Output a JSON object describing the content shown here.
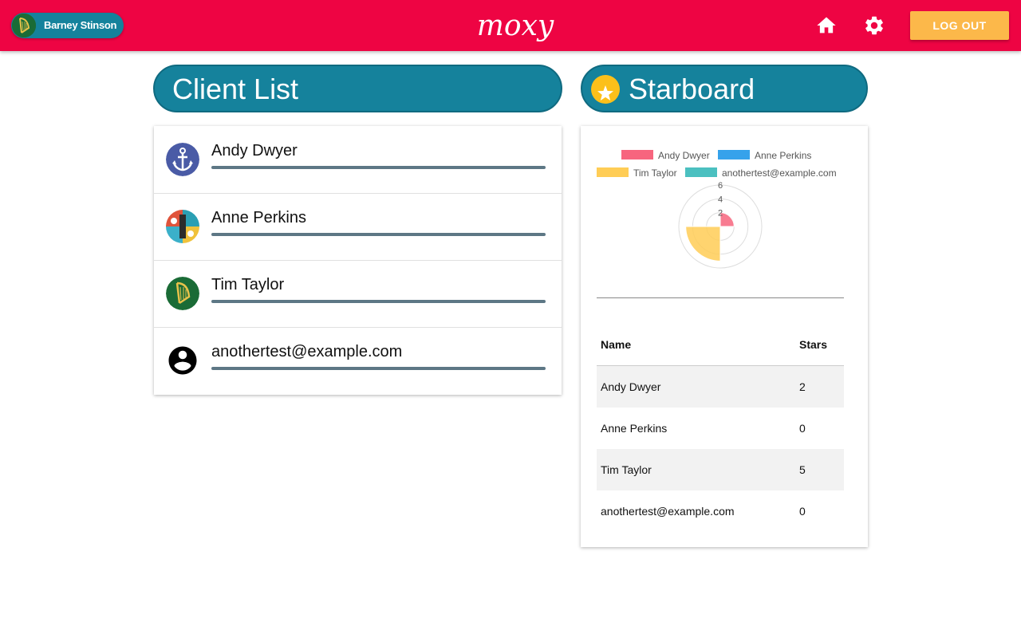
{
  "header": {
    "user_name": "Barney Stinson",
    "logo_text": "moxy",
    "logout_label": "LOG OUT",
    "icons": [
      "harp-icon",
      "home-icon",
      "gear-icon"
    ],
    "colors": {
      "bar": "#ee0443",
      "accent": "#15829c",
      "logout": "#fcb84a"
    }
  },
  "client_list": {
    "title": "Client List",
    "clients": [
      {
        "name": "Andy Dwyer",
        "avatar": "anchor-icon"
      },
      {
        "name": "Anne Perkins",
        "avatar": "collage-avatar"
      },
      {
        "name": "Tim Taylor",
        "avatar": "harp-icon"
      },
      {
        "name": "anothertest@example.com",
        "avatar": "account-circle-icon"
      }
    ]
  },
  "starboard": {
    "title": "Starboard",
    "table": {
      "headers": [
        "Name",
        "Stars"
      ],
      "rows": [
        {
          "name": "Andy Dwyer",
          "stars": "2"
        },
        {
          "name": "Anne Perkins",
          "stars": "0"
        },
        {
          "name": "Tim Taylor",
          "stars": "5"
        },
        {
          "name": "anothertest@example.com",
          "stars": "0"
        }
      ]
    }
  },
  "chart_data": {
    "type": "polarArea",
    "categories": [
      "Andy Dwyer",
      "Anne Perkins",
      "Tim Taylor",
      "anothertest@example.com"
    ],
    "values": [
      2,
      0,
      5,
      0
    ],
    "colors": [
      "#f7657e",
      "#36a2eb",
      "#ffcd56",
      "#4bc0c0"
    ],
    "r_ticks": [
      "2",
      "4",
      "6"
    ],
    "rlim": [
      0,
      6
    ],
    "legend": "top"
  }
}
